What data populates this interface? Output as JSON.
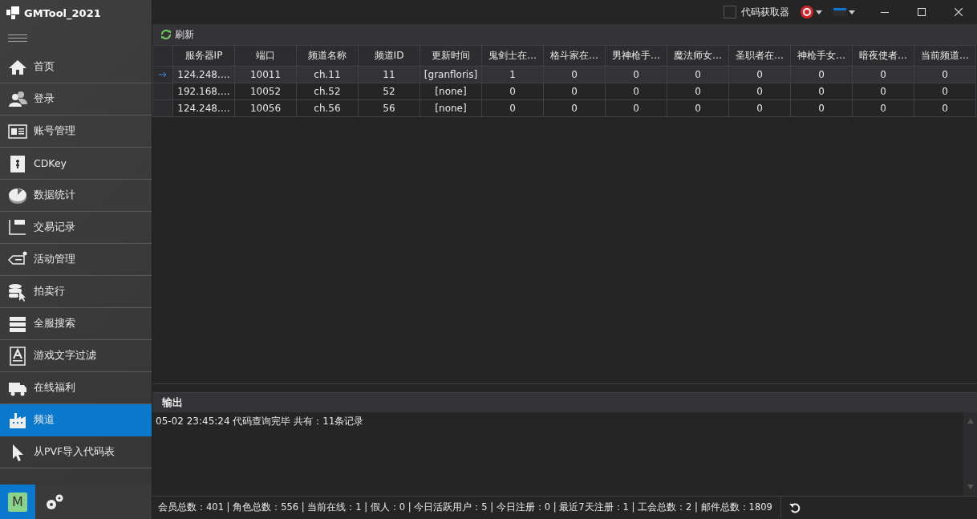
{
  "window": {
    "title": "GMTool_2021"
  },
  "titlebar": {
    "code_fetcher": {
      "label": "代码获取器",
      "checked": false
    }
  },
  "sidebar": {
    "items": [
      {
        "label": "首页",
        "selected": false
      },
      {
        "label": "登录",
        "selected": false
      },
      {
        "label": "账号管理",
        "selected": false
      },
      {
        "label": "CDKey",
        "selected": false
      },
      {
        "label": "数据统计",
        "selected": false
      },
      {
        "label": "交易记录",
        "selected": false
      },
      {
        "label": "活动管理",
        "selected": false
      },
      {
        "label": "拍卖行",
        "selected": false
      },
      {
        "label": "全服搜索",
        "selected": false
      },
      {
        "label": "游戏文字过滤",
        "selected": false
      },
      {
        "label": "在线福利",
        "selected": false
      },
      {
        "label": "频道",
        "selected": true
      },
      {
        "label": "从PVF导入代码表",
        "selected": false
      }
    ],
    "avatar": "M"
  },
  "toolbar": {
    "refresh": "刷新"
  },
  "table": {
    "columns": [
      "服务器IP",
      "端口",
      "频道名称",
      "频道ID",
      "更新时间",
      "鬼剑士在…",
      "格斗家在…",
      "男神枪手…",
      "魔法师女…",
      "圣职者在…",
      "神枪手女…",
      "暗夜使者…",
      "当前频道…"
    ],
    "rows": [
      {
        "selected": true,
        "cells": [
          "124.248.…",
          "10011",
          "ch.11",
          "11",
          "[granfloris]",
          "1",
          "0",
          "0",
          "0",
          "0",
          "0",
          "0",
          "0"
        ]
      },
      {
        "selected": false,
        "cells": [
          "192.168.…",
          "10052",
          "ch.52",
          "52",
          "[none]",
          "0",
          "0",
          "0",
          "0",
          "0",
          "0",
          "0",
          "0"
        ]
      },
      {
        "selected": false,
        "cells": [
          "124.248.…",
          "10056",
          "ch.56",
          "56",
          "[none]",
          "0",
          "0",
          "0",
          "0",
          "0",
          "0",
          "0",
          "0"
        ]
      }
    ]
  },
  "output": {
    "title": "输出",
    "lines": [
      "05-02 23:45:24 代码查询完毕 共有：11条记录"
    ]
  },
  "status_bar": {
    "text": "会员总数：401 | 角色总数：556 | 当前在线：1 | 假人：0 | 今日活跃用户：5 | 今日注册：0 | 最近7天注册：1 | 工会总数：2 | 邮件总数：1809"
  }
}
